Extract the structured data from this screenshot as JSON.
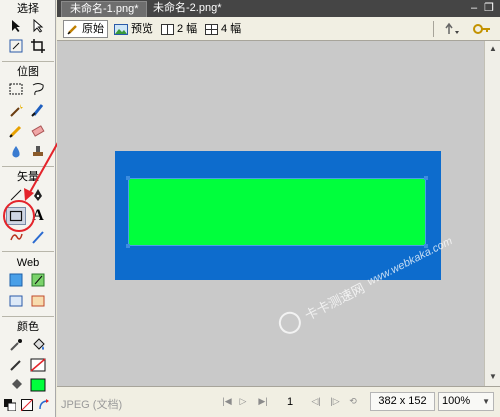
{
  "toolbox": {
    "sections": {
      "select": "选择",
      "bitmap": "位图",
      "vector": "矢量",
      "web": "Web",
      "colors": "颜色"
    },
    "vector_text_tool": "A"
  },
  "document": {
    "tabs": [
      {
        "label": "未命名-1.png*",
        "active": true
      },
      {
        "label": "未命名-2.png*",
        "active": false
      }
    ],
    "window_buttons": {
      "minimize": "–",
      "restore": "❐"
    },
    "views": [
      {
        "label": "原始",
        "icon": "pencil-icon",
        "active": true
      },
      {
        "label": "预览",
        "icon": "image-preview-icon",
        "active": false
      },
      {
        "label": "2 幅",
        "icon": "two-up-icon",
        "active": false
      },
      {
        "label": "4 幅",
        "icon": "four-up-icon",
        "active": false
      }
    ]
  },
  "canvas": {
    "outer_color": "#0d6ccd",
    "inner_color": "#00ff3c",
    "background": "#c9c9c9"
  },
  "watermark": {
    "text_cn": "卡卡测速网",
    "url": "www.webkaka.com"
  },
  "statusbar": {
    "file_type": "JPEG (文档)",
    "frame": "1",
    "dimensions": "382 x 152",
    "zoom": "100%"
  },
  "annotation": {
    "color": "#e4242b"
  }
}
